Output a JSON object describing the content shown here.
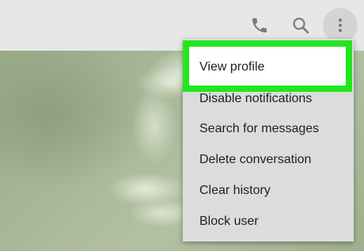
{
  "topbar": {
    "icons": [
      "phone-icon",
      "search-icon",
      "more-vertical-icon"
    ]
  },
  "menu": {
    "items": [
      {
        "label": "View profile",
        "highlighted": true
      },
      {
        "label": "Disable notifications"
      },
      {
        "label": "Search for messages"
      },
      {
        "label": "Delete conversation"
      },
      {
        "label": "Clear history"
      },
      {
        "label": "Block user"
      }
    ]
  },
  "colors": {
    "highlight_border": "#22e61e",
    "topbar_bg": "#e7e7e7",
    "menu_bg": "#dcdcdc",
    "icon_color": "#7a7a7a"
  }
}
